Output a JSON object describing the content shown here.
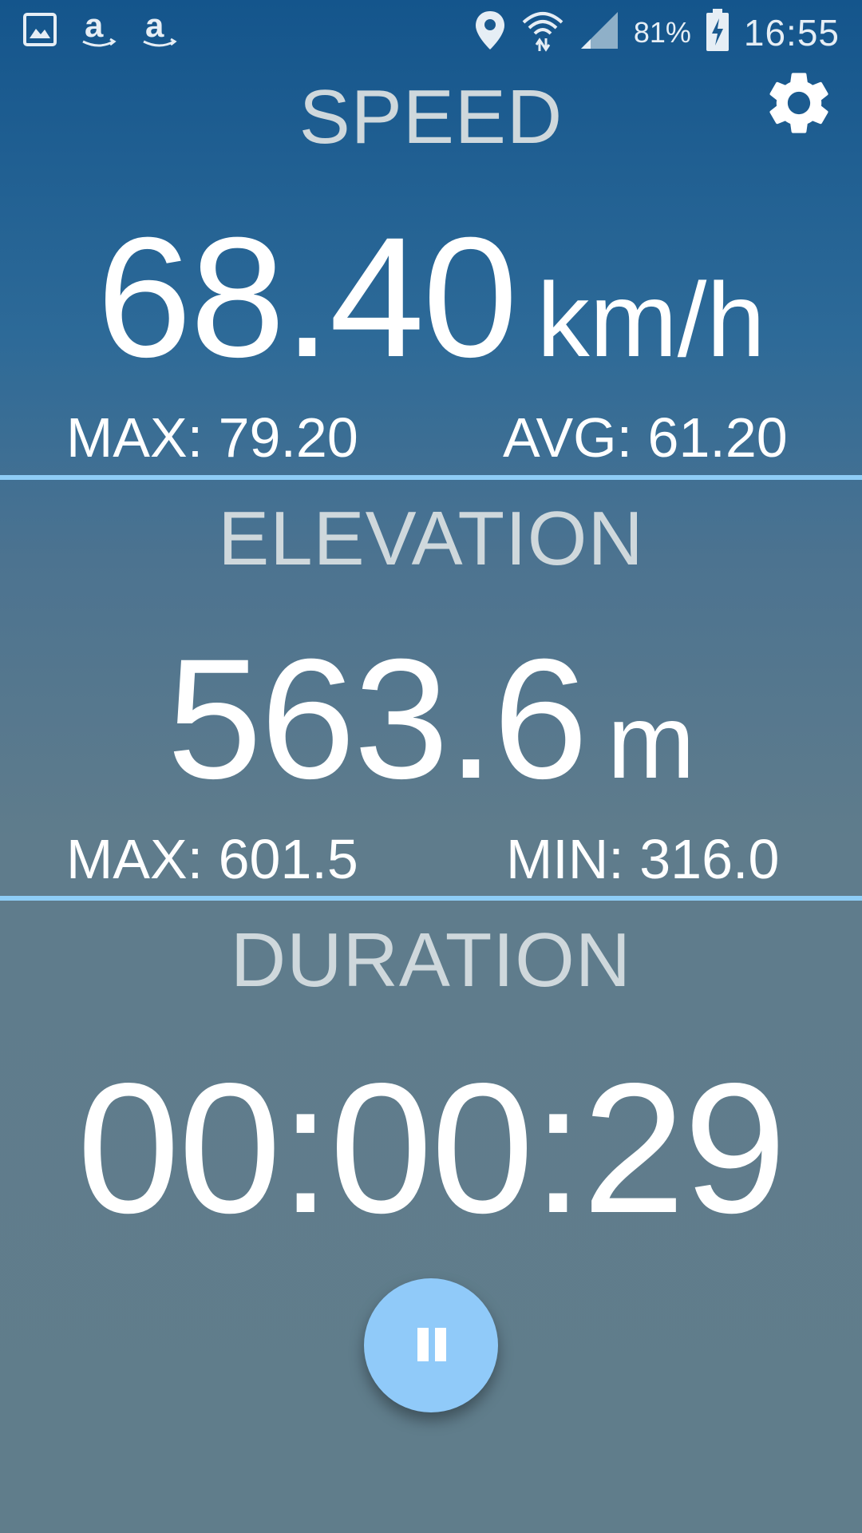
{
  "status_bar": {
    "left_icons": [
      "gallery-icon",
      "amazon-icon",
      "amazon-icon"
    ],
    "right_icons": [
      "location-icon",
      "wifi-icon",
      "signal-icon",
      "battery-charging-icon"
    ],
    "battery_percent": "81%",
    "time": "16:55"
  },
  "speed": {
    "title": "SPEED",
    "value": "68.40",
    "unit": "km/h",
    "max_text": "MAX: 79.20",
    "avg_text": "AVG: 61.20"
  },
  "elevation": {
    "title": "ELEVATION",
    "value": "563.6",
    "unit": "m",
    "max_text": "MAX: 601.5",
    "min_text": "MIN: 316.0"
  },
  "duration": {
    "title": "DURATION",
    "value": "00:00:29"
  },
  "controls": {
    "settings_icon": "gear-icon",
    "pause_icon": "pause-icon"
  },
  "colors": {
    "background_top": "#14558c",
    "background_bottom": "#607d8b",
    "divider": "#8ecdf6",
    "title_text": "#cfd8dc",
    "pause_button": "#90caf9"
  }
}
